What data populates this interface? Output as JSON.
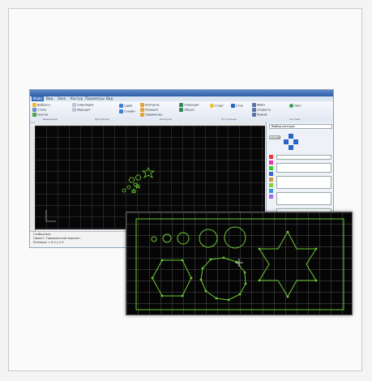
{
  "window": {
    "title": "",
    "tabs": [
      "Файл",
      "Вид",
      "Зона",
      "Контур",
      "Параметры",
      "Вид"
    ],
    "active_tab": 1
  },
  "ribbon": {
    "row1": [
      "Выбрать",
      "Стиль",
      "Симуляция",
      "Сдвиг",
      "Сплайн",
      "Операция",
      "Старт",
      "Стоп",
      "Файл",
      "Лист"
    ],
    "row2": [
      "Группа",
      "Маршрут",
      "Контроль",
      "Позиция",
      "Скорость"
    ],
    "row3": [
      "Параметры",
      "Объект",
      "Режим"
    ],
    "group_labels": [
      "Выделение",
      "Программа",
      "Контроль",
      "Построение",
      "Система"
    ]
  },
  "panel": {
    "header": "Выбор контура",
    "value": "125,000"
  },
  "status": {
    "line1": "Сообщения",
    "line2": "Проект: Проверочный вариант",
    "line3": "Размеры: x 0.0  y 0.0"
  },
  "accent": "#2f5fa8",
  "contour_color": "#6ccc33"
}
